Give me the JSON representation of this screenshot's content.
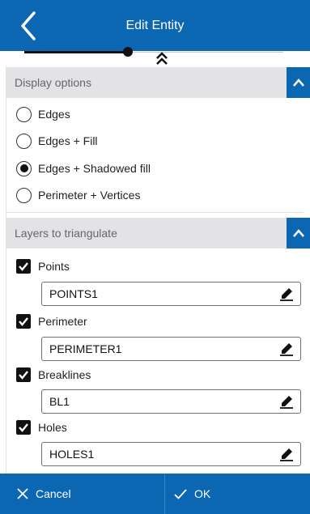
{
  "header": {
    "title": "Edit Entity",
    "background": "#0b67b1"
  },
  "slider": {
    "level": 0.36
  },
  "display_options": {
    "title": "Display options",
    "options": [
      {
        "label": "Edges",
        "selected": false
      },
      {
        "label": "Edges + Fill",
        "selected": false
      },
      {
        "label": "Edges + Shadowed fill",
        "selected": true
      },
      {
        "label": "Perimeter + Vertices",
        "selected": false
      }
    ]
  },
  "layers": {
    "title": "Layers to triangulate",
    "items": [
      {
        "label": "Points",
        "checked": true,
        "value": "POINTS1"
      },
      {
        "label": "Perimeter",
        "checked": true,
        "value": "PERIMETER1"
      },
      {
        "label": "Breaklines",
        "checked": true,
        "value": "BL1"
      },
      {
        "label": "Holes",
        "checked": true,
        "value": "HOLES1"
      }
    ]
  },
  "footer": {
    "cancel_label": "Cancel",
    "ok_label": "OK"
  },
  "icons": {
    "back": "chevron-left-icon",
    "collapse": "double-chevron-up-icon",
    "section_toggle": "chevron-up-icon",
    "edit": "pencil-icon",
    "cancel": "x-icon",
    "ok": "checkmark-icon"
  }
}
